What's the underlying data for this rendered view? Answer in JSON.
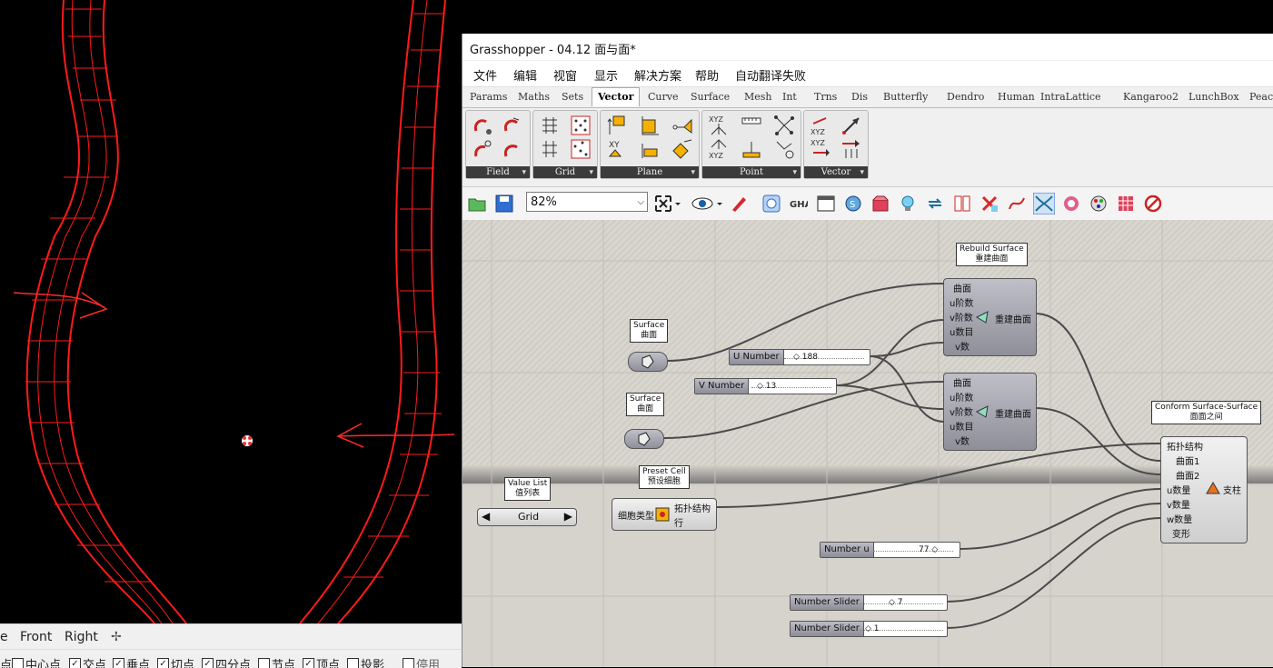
{
  "rhino": {
    "view_tabs": [
      "e",
      "Front",
      "Right",
      "✢"
    ],
    "osnaps": [
      {
        "label": "点",
        "checked": false,
        "has_box": false
      },
      {
        "label": "中心点",
        "checked": false,
        "has_box": true
      },
      {
        "label": "交点",
        "checked": true,
        "has_box": true
      },
      {
        "label": "垂点",
        "checked": true,
        "has_box": true
      },
      {
        "label": "切点",
        "checked": true,
        "has_box": true
      },
      {
        "label": "四分点",
        "checked": true,
        "has_box": true
      },
      {
        "label": "节点",
        "checked": false,
        "has_box": true
      },
      {
        "label": "顶点",
        "checked": true,
        "has_box": true
      },
      {
        "label": "投影",
        "checked": false,
        "has_box": true
      },
      {
        "label": "停用",
        "checked": false,
        "has_box": true
      }
    ],
    "wire_color": "#ff1a1a"
  },
  "gh": {
    "title": "Grasshopper - 04.12 面与面*",
    "menu": [
      "文件",
      "编辑",
      "视窗",
      "显示",
      "解决方案",
      "帮助",
      "自动翻译失败"
    ],
    "category_tabs": [
      "Params",
      "Maths",
      "Sets",
      "Vector",
      "Curve",
      "Surface",
      "Mesh",
      "Int",
      "Trns",
      "Dis",
      "Butterfly",
      "Dendro",
      "Human",
      "IntraLattice",
      "Kangaroo2",
      "LunchBox",
      "Peaco"
    ],
    "active_tab": "Vector",
    "panels": [
      "Field",
      "Grid",
      "Plane",
      "Point",
      "Vector"
    ],
    "zoom": "82%",
    "nodes": {
      "rebuild_label": [
        "Rebuild Surface",
        "重建曲面"
      ],
      "rebuild_inputs": [
        "曲面",
        "u阶数",
        "v阶数",
        "u数目",
        "v数"
      ],
      "rebuild_output": "重建曲面",
      "rebuild2_inputs": [
        "曲面",
        "u阶数",
        "v阶数",
        "u数目",
        "v数"
      ],
      "rebuild2_output": "重建曲面",
      "surface1_label": [
        "Surface",
        "曲面"
      ],
      "surface2_label": [
        "Surface",
        "曲面"
      ],
      "conform_label": [
        "Conform Surface-Surface",
        "面面之间"
      ],
      "conform_inputs": [
        "拓扑结构",
        "曲面1",
        "曲面2",
        "u数量",
        "v数量",
        "w数量",
        "变形"
      ],
      "conform_output": "支柱",
      "valuelist_label": [
        "Value List",
        "值列表"
      ],
      "valuelist_value": "Grid",
      "presetcell_label": [
        "Preset Cell",
        "预设细胞"
      ],
      "presetcell_input": "细胞类型",
      "presetcell_outputs": [
        "拓扑结构",
        "行"
      ]
    },
    "sliders": {
      "u_number": {
        "name": "U Number",
        "value": "188"
      },
      "v_number": {
        "name": "V Number",
        "value": "13"
      },
      "number_u": {
        "name": "Number u",
        "value": "77"
      },
      "slider_a": {
        "name": "Number Slider",
        "value": "7"
      },
      "slider_b": {
        "name": "Number Slider",
        "value": "1"
      }
    }
  }
}
